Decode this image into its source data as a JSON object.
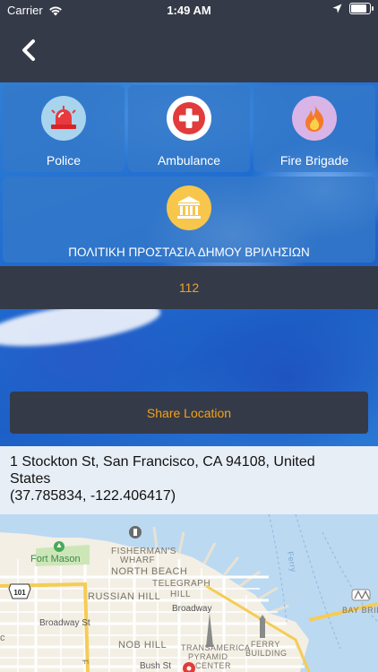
{
  "status_bar": {
    "carrier": "Carrier",
    "time": "1:49 AM",
    "battery_level": 0.92
  },
  "nav": {
    "back_icon": "chevron-left-icon"
  },
  "services": {
    "police": {
      "label": "Police",
      "icon": "police-siren-icon",
      "icon_bg": "#a8d4ee"
    },
    "ambulance": {
      "label": "Ambulance",
      "icon": "medical-cross-icon",
      "icon_bg": "#ffffff"
    },
    "fire": {
      "label": "Fire Brigade",
      "icon": "fire-icon",
      "icon_bg": "#d9b4e6"
    },
    "civil_protection": {
      "label": "ΠΟΛΙΤΙΚΗ ΠΡΟΣΤΑΣΙΑ ΔΗΜΟΥ ΒΡΙΛΗΣΙΩΝ",
      "icon": "building-icon",
      "icon_bg": "#f7c64a"
    }
  },
  "emergency_number": "112",
  "share_button_label": "Share Location",
  "location": {
    "address": "1 Stockton St, San Francisco, CA  94108, United States",
    "coordinates": "(37.785834, -122.406417)"
  },
  "map": {
    "labels": {
      "fort_mason": "Fort Mason",
      "fishermans_wharf_1": "FISHERMAN'S",
      "fishermans_wharf_2": "WHARF",
      "north_beach": "NORTH BEACH",
      "telegraph_hill_1": "TELEGRAPH",
      "telegraph_hill_2": "HILL",
      "russian_hill": "RUSSIAN HILL",
      "broadway_1": "Broadway",
      "broadway_st": "Broadway St",
      "nob_hill": "NOB HILL",
      "transamerica_1": "TRANSAMERICA",
      "transamerica_2": "PYRAMID",
      "transamerica_3": "CENTER",
      "ferry_building_1": "FERRY",
      "ferry_building_2": "BUILDING",
      "bay_bridge": "BAY BRIDG",
      "bush_st": "Bush St",
      "highway_101": "101",
      "ferry_route": "Ferry",
      "edge_c": "c",
      "edge_f": "F"
    }
  },
  "colors": {
    "dark_bar": "#353a48",
    "accent_orange": "#f3a21c",
    "tile_blue": "#3578c8"
  }
}
